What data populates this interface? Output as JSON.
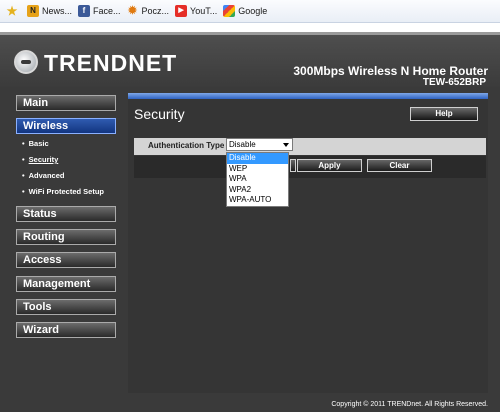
{
  "bookmarks": [
    {
      "label": ""
    },
    {
      "label": "News..."
    },
    {
      "label": "Face..."
    },
    {
      "label": "Pocz..."
    },
    {
      "label": "YouT..."
    },
    {
      "label": "Google"
    }
  ],
  "header": {
    "logo_text": "TRENDNET",
    "product_name": "300Mbps Wireless N Home Router",
    "model": "TEW-652BRP"
  },
  "sidebar": {
    "main": "Main",
    "wireless": "Wireless",
    "wireless_sub": [
      "Basic",
      "Security",
      "Advanced",
      "WiFi Protected Setup"
    ],
    "status": "Status",
    "routing": "Routing",
    "access": "Access",
    "management": "Management",
    "tools": "Tools",
    "wizard": "Wizard"
  },
  "main": {
    "title": "Security",
    "help_label": "Help",
    "auth_label": "Authentication Type",
    "auth_value": "Disable",
    "auth_options": [
      "Disable",
      "WEP",
      "WPA",
      "WPA2",
      "WPA-AUTO"
    ],
    "apply_label": "Apply",
    "clear_label": "Clear"
  },
  "footer": {
    "copyright": "Copyright © 2011 TRENDnet. All Rights Reserved."
  },
  "colors": {
    "active_nav": "#1e4a9e",
    "dropdown_highlight": "#3399ff"
  }
}
